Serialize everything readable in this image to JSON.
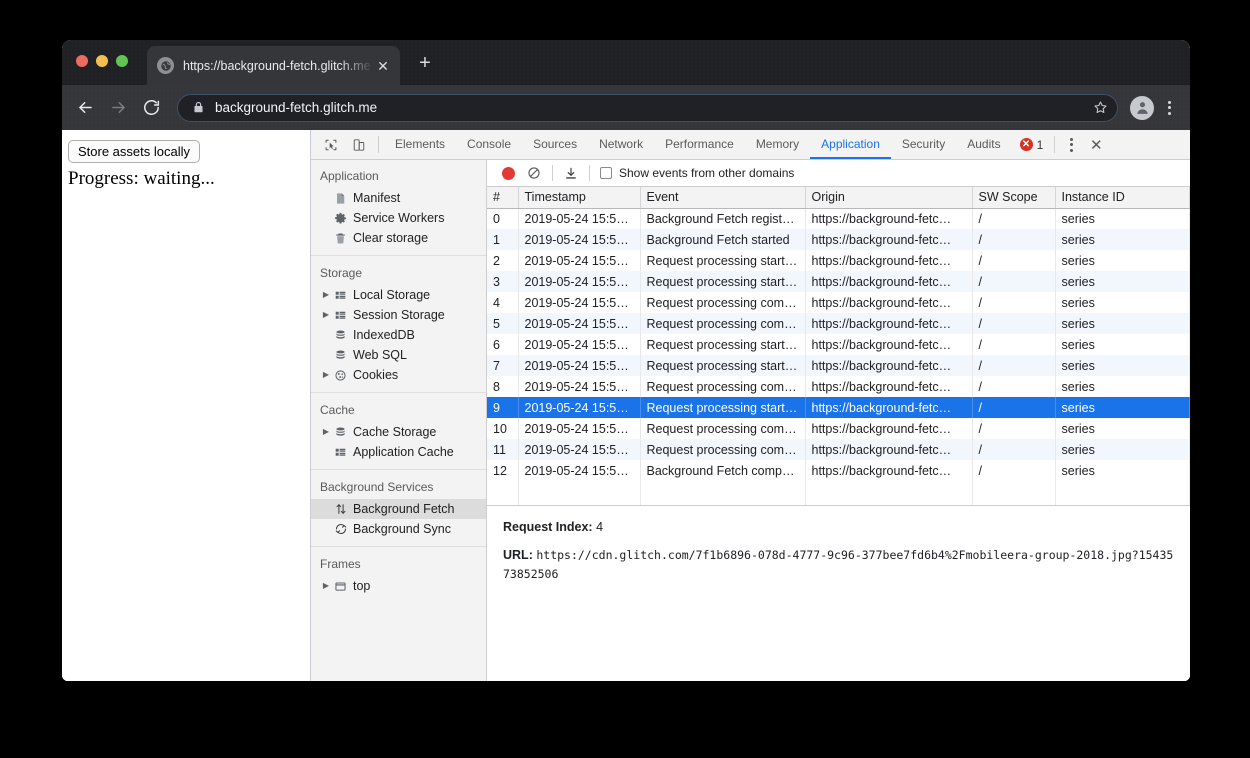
{
  "browser": {
    "tab": {
      "title": "https://background-fetch.glitch.me",
      "favicon": "globe-icon",
      "close_label": "✕"
    },
    "new_tab_label": "+",
    "nav": {
      "back_label": "back-arrow-icon",
      "forward_label": "forward-arrow-icon",
      "reload_label": "reload-icon"
    },
    "omnibox": {
      "url": "background-fetch.glitch.me",
      "lock_icon": "lock-icon",
      "star_icon": "star-icon"
    },
    "profile_icon": "avatar-icon",
    "menu_icon": "kebab-menu-icon"
  },
  "page": {
    "store_assets_button": "Store assets locally",
    "progress_text": "Progress: waiting..."
  },
  "devtools": {
    "tabs": [
      {
        "label": "Elements",
        "active": false
      },
      {
        "label": "Console",
        "active": false
      },
      {
        "label": "Sources",
        "active": false
      },
      {
        "label": "Network",
        "active": false
      },
      {
        "label": "Performance",
        "active": false
      },
      {
        "label": "Memory",
        "active": false
      },
      {
        "label": "Application",
        "active": true
      },
      {
        "label": "Security",
        "active": false
      },
      {
        "label": "Audits",
        "active": false
      }
    ],
    "error_count": "1",
    "more_label": "kebab-menu-icon",
    "close_label": "✕",
    "inspect_icon": "inspect-element-icon",
    "device_icon": "device-toolbar-icon",
    "accent_color": "#1a73e8",
    "error_color": "#d93025"
  },
  "sidebar": {
    "sections": [
      {
        "title": "Application",
        "items": [
          {
            "label": "Manifest",
            "icon": "manifest-document-icon",
            "arrow": false,
            "selected": false
          },
          {
            "label": "Service Workers",
            "icon": "gear-icon",
            "arrow": false,
            "selected": false
          },
          {
            "label": "Clear storage",
            "icon": "trash-icon",
            "arrow": false,
            "selected": false
          }
        ]
      },
      {
        "title": "Storage",
        "items": [
          {
            "label": "Local Storage",
            "icon": "table-grid-icon",
            "arrow": true,
            "selected": false
          },
          {
            "label": "Session Storage",
            "icon": "table-grid-icon",
            "arrow": true,
            "selected": false
          },
          {
            "label": "IndexedDB",
            "icon": "database-icon",
            "arrow": false,
            "selected": false
          },
          {
            "label": "Web SQL",
            "icon": "database-icon",
            "arrow": false,
            "selected": false
          },
          {
            "label": "Cookies",
            "icon": "cookie-icon",
            "arrow": true,
            "selected": false
          }
        ]
      },
      {
        "title": "Cache",
        "items": [
          {
            "label": "Cache Storage",
            "icon": "database-icon",
            "arrow": true,
            "selected": false
          },
          {
            "label": "Application Cache",
            "icon": "table-grid-icon",
            "arrow": false,
            "selected": false
          }
        ]
      },
      {
        "title": "Background Services",
        "items": [
          {
            "label": "Background Fetch",
            "icon": "up-down-arrows-icon",
            "arrow": false,
            "selected": true
          },
          {
            "label": "Background Sync",
            "icon": "sync-refresh-icon",
            "arrow": false,
            "selected": false
          }
        ]
      },
      {
        "title": "Frames",
        "items": [
          {
            "label": "top",
            "icon": "frame-window-icon",
            "arrow": true,
            "selected": false
          }
        ]
      }
    ]
  },
  "toolbar": {
    "record_icon": "record-circle-icon",
    "clear_icon": "clear-prohibited-icon",
    "export_icon": "download-export-icon",
    "show_other_domains_label": "Show events from other domains",
    "show_other_domains_checked": false
  },
  "events_table": {
    "columns": [
      "#",
      "Timestamp",
      "Event",
      "Origin",
      "SW Scope",
      "Instance ID"
    ],
    "rows": [
      {
        "num": "0",
        "timestamp": "2019-05-24 15:5…",
        "event": "Background Fetch regist…",
        "origin": "https://background-fetc…",
        "scope": "/",
        "instance": "series",
        "selected": false
      },
      {
        "num": "1",
        "timestamp": "2019-05-24 15:5…",
        "event": "Background Fetch started",
        "origin": "https://background-fetc…",
        "scope": "/",
        "instance": "series",
        "selected": false
      },
      {
        "num": "2",
        "timestamp": "2019-05-24 15:5…",
        "event": "Request processing start…",
        "origin": "https://background-fetc…",
        "scope": "/",
        "instance": "series",
        "selected": false
      },
      {
        "num": "3",
        "timestamp": "2019-05-24 15:5…",
        "event": "Request processing start…",
        "origin": "https://background-fetc…",
        "scope": "/",
        "instance": "series",
        "selected": false
      },
      {
        "num": "4",
        "timestamp": "2019-05-24 15:5…",
        "event": "Request processing com…",
        "origin": "https://background-fetc…",
        "scope": "/",
        "instance": "series",
        "selected": false
      },
      {
        "num": "5",
        "timestamp": "2019-05-24 15:5…",
        "event": "Request processing com…",
        "origin": "https://background-fetc…",
        "scope": "/",
        "instance": "series",
        "selected": false
      },
      {
        "num": "6",
        "timestamp": "2019-05-24 15:5…",
        "event": "Request processing start…",
        "origin": "https://background-fetc…",
        "scope": "/",
        "instance": "series",
        "selected": false
      },
      {
        "num": "7",
        "timestamp": "2019-05-24 15:5…",
        "event": "Request processing start…",
        "origin": "https://background-fetc…",
        "scope": "/",
        "instance": "series",
        "selected": false
      },
      {
        "num": "8",
        "timestamp": "2019-05-24 15:5…",
        "event": "Request processing com…",
        "origin": "https://background-fetc…",
        "scope": "/",
        "instance": "series",
        "selected": false
      },
      {
        "num": "9",
        "timestamp": "2019-05-24 15:5…",
        "event": "Request processing start…",
        "origin": "https://background-fetc…",
        "scope": "/",
        "instance": "series",
        "selected": true
      },
      {
        "num": "10",
        "timestamp": "2019-05-24 15:5…",
        "event": "Request processing com…",
        "origin": "https://background-fetc…",
        "scope": "/",
        "instance": "series",
        "selected": false
      },
      {
        "num": "11",
        "timestamp": "2019-05-24 15:5…",
        "event": "Request processing com…",
        "origin": "https://background-fetc…",
        "scope": "/",
        "instance": "series",
        "selected": false
      },
      {
        "num": "12",
        "timestamp": "2019-05-24 15:5…",
        "event": "Background Fetch comp…",
        "origin": "https://background-fetc…",
        "scope": "/",
        "instance": "series",
        "selected": false
      }
    ]
  },
  "detail": {
    "request_index_key": "Request Index:",
    "request_index_value": "4",
    "url_key": "URL:",
    "url_value": "https://cdn.glitch.com/7f1b6896-078d-4777-9c96-377bee7fd6b4%2Fmobileera-group-2018.jpg?1543573852506"
  }
}
